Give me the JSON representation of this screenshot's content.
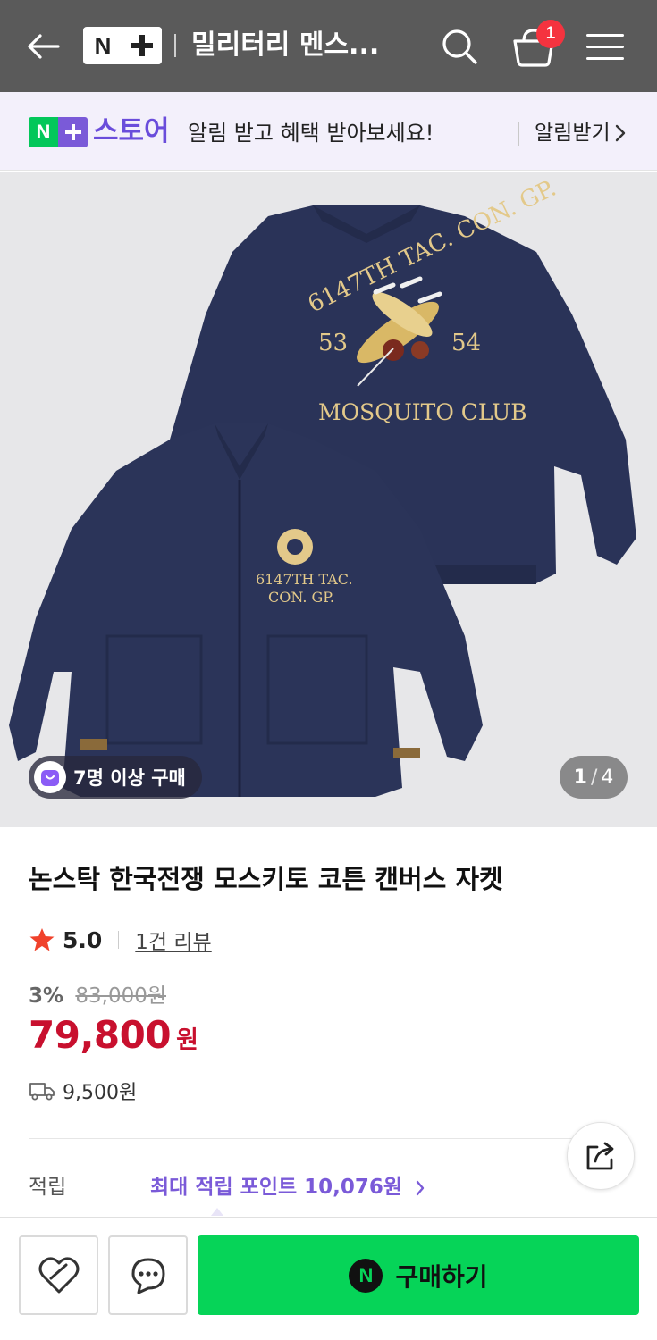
{
  "header": {
    "logo_n": "N",
    "store_title": "밀리터리 멘스...",
    "cart_count": "1"
  },
  "banner": {
    "logo_n": "N",
    "store": "스토어",
    "text": "알림 받고 혜택 받아보세요!",
    "action": "알림받기"
  },
  "gallery": {
    "badge": "7명 이상 구매",
    "current": "1",
    "separator": "/",
    "total": "4",
    "artwork": {
      "back_top": "6147TH TAC. CON. GP.",
      "back_left": "53",
      "back_right": "54",
      "back_bottom": "MOSQUITO CLUB",
      "front_line1": "6147TH TAC.",
      "front_line2": "CON. GP.",
      "jacket_color": "#2a3358",
      "embroidery_color": "#e3c98a"
    }
  },
  "product": {
    "title": "논스탁 한국전쟁 모스키토 코튼 캔버스 자켓",
    "rating": "5.0",
    "reviews": "1건 리뷰",
    "discount_pct": "3%",
    "original_price": "83,000원",
    "price": "79,800",
    "price_unit": "원",
    "shipping": "9,500원"
  },
  "points": {
    "label": "적립",
    "value": "최대 적립 포인트 10,076원"
  },
  "actions": {
    "buy_logo": "N",
    "buy_label": "구매하기"
  },
  "colors": {
    "header_bg": "#5a5a5a",
    "naver_green": "#03c75a",
    "store_purple": "#7a5ad8",
    "price_red": "#c8102e",
    "star": "#f0422b",
    "buy_green": "#06d458"
  }
}
